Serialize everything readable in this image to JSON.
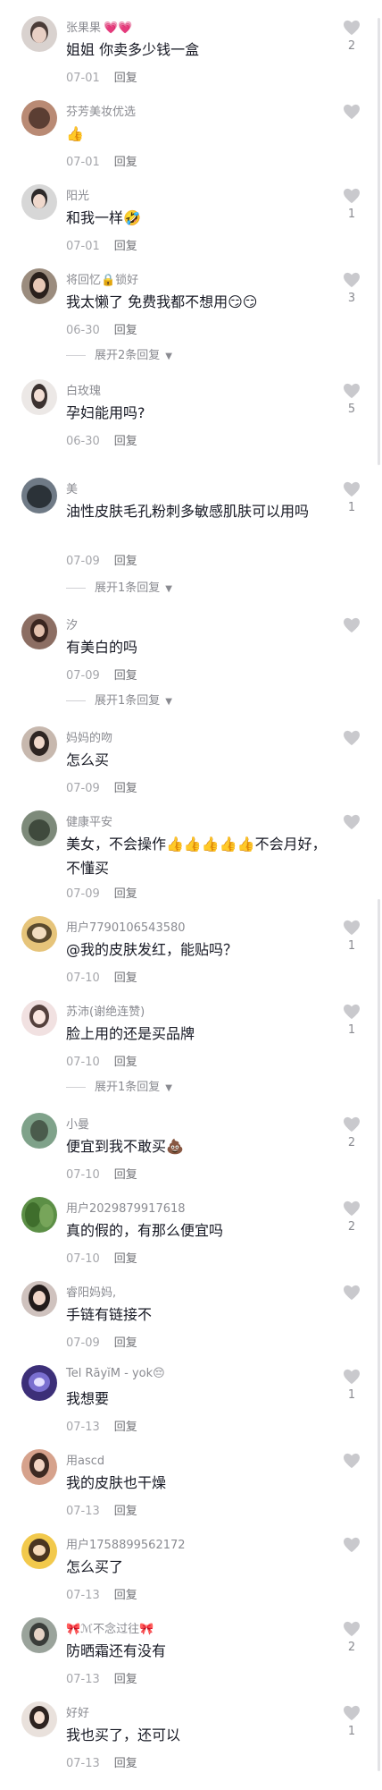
{
  "reply_label": "回复",
  "comments": [
    {
      "user": "张果果",
      "user_decor": "💗💗",
      "text": "姐姐 你卖多少钱一盒",
      "date": "07-01",
      "likes": "2",
      "expand": ""
    },
    {
      "user": "芬芳美妆优选",
      "user_decor": "",
      "text": "👍",
      "date": "07-01",
      "likes": "",
      "expand": ""
    },
    {
      "user": "阳光",
      "user_decor": "",
      "text": "和我一样🤣",
      "date": "07-01",
      "likes": "1",
      "expand": ""
    },
    {
      "user": "将回忆🔒锁好",
      "user_decor": "",
      "text": "我太懒了 免费我都不想用😏😏",
      "date": "06-30",
      "likes": "3",
      "expand": "展开2条回复"
    },
    {
      "user": "白玫瑰",
      "user_decor": "",
      "text": "孕妇能用吗?",
      "date": "06-30",
      "likes": "5",
      "expand": ""
    },
    {
      "user": "美",
      "user_decor": "",
      "text": "油性皮肤毛孔粉刺多敏感肌肤可以用吗",
      "date": "07-09",
      "likes": "1",
      "expand": "展开1条回复"
    },
    {
      "user": "汐",
      "user_decor": "",
      "text": "有美白的吗",
      "date": "07-09",
      "likes": "",
      "expand": "展开1条回复"
    },
    {
      "user": "妈妈的吻",
      "user_decor": "",
      "text": "怎么买",
      "date": "07-09",
      "likes": "",
      "expand": ""
    },
    {
      "user": "健康平安",
      "user_decor": "",
      "text": "美女，不会操作👍👍👍👍👍不会月好，不懂买",
      "date": "07-09",
      "likes": "",
      "expand": ""
    },
    {
      "user": "用户7790106543580",
      "user_decor": "",
      "text": "@我的皮肤发红，能贴吗？",
      "date": "07-10",
      "likes": "1",
      "expand": ""
    },
    {
      "user": "苏沛(谢绝连赞)",
      "user_decor": "",
      "text": "脸上用的还是买品牌",
      "date": "07-10",
      "likes": "1",
      "expand": "展开1条回复"
    },
    {
      "user": "小曼",
      "user_decor": "",
      "text": "便宜到我不敢买💩",
      "date": "07-10",
      "likes": "2",
      "expand": ""
    },
    {
      "user": "用户2029879917618",
      "user_decor": "",
      "text": "真的假的，有那么便宜吗",
      "date": "07-10",
      "likes": "2",
      "expand": ""
    },
    {
      "user": "睿阳妈妈,",
      "user_decor": "",
      "text": "手链有链接不",
      "date": "07-09",
      "likes": "",
      "expand": ""
    },
    {
      "user": "Tel  RāyĭM - yok😔",
      "user_decor": "",
      "text": "我想要",
      "date": "07-13",
      "likes": "1",
      "expand": ""
    },
    {
      "user": "用ascd",
      "user_decor": "",
      "text": "我的皮肤也干燥",
      "date": "07-13",
      "likes": "",
      "expand": ""
    },
    {
      "user": "用户1758899562172",
      "user_decor": "",
      "text": "怎么买了",
      "date": "07-13",
      "likes": "",
      "expand": ""
    },
    {
      "user": "🎀ℳ不念过往🎀",
      "user_decor": "",
      "text": "防晒霜还有没有",
      "date": "07-13",
      "likes": "2",
      "expand": ""
    },
    {
      "user": "好好",
      "user_decor": "",
      "text": "我也买了，还可以",
      "date": "07-13",
      "likes": "1",
      "expand": ""
    }
  ],
  "colors": {
    "text": "#161823",
    "secondary": "#8a8b91",
    "heart": "#c9c9cd"
  }
}
